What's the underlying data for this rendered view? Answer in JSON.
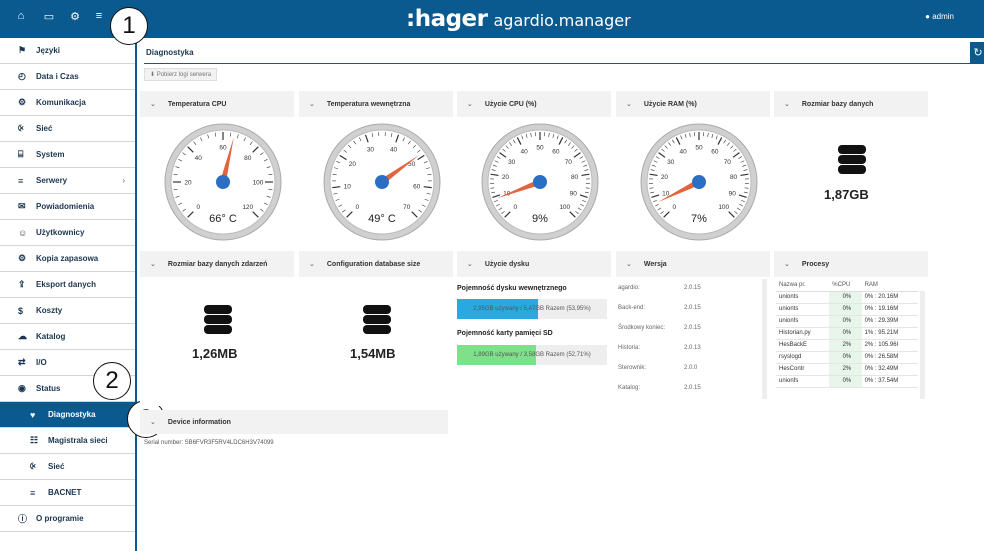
{
  "topbar": {
    "icons": [
      "home-icon",
      "monitor-icon",
      "gears-icon",
      "menu-icon"
    ],
    "logo": ":hager",
    "logo_sub": "agardio.manager",
    "user": "admin"
  },
  "callouts": [
    "1",
    "2",
    "3"
  ],
  "sidebar": {
    "items": [
      {
        "label": "Języki",
        "icon": "flag-icon"
      },
      {
        "label": "Data i Czas",
        "icon": "clock-icon"
      },
      {
        "label": "Komunikacja",
        "icon": "gears-icon"
      },
      {
        "label": "Sieć",
        "icon": "share-icon"
      },
      {
        "label": "System",
        "icon": "hdd-icon"
      },
      {
        "label": "Serwery",
        "icon": "server-icon",
        "arrow": "›"
      },
      {
        "label": "Powiadomienia",
        "icon": "envelope-icon"
      },
      {
        "label": "Użytkownicy",
        "icon": "users-icon"
      },
      {
        "label": "Kopia zapasowa",
        "icon": "gears-icon"
      },
      {
        "label": "Eksport danych",
        "icon": "upload-icon"
      },
      {
        "label": "Koszty",
        "icon": "dollar-icon"
      },
      {
        "label": "Katalog",
        "icon": "cloud-icon"
      },
      {
        "label": "I/O",
        "icon": "exchange-icon"
      },
      {
        "label": "Status",
        "icon": "eye-icon"
      },
      {
        "label": "Diagnostyka",
        "icon": "heartbeat-icon",
        "active": true,
        "sub": true
      },
      {
        "label": "Magistrala sieci",
        "icon": "sitemap-icon",
        "sub": true
      },
      {
        "label": "Sieć",
        "icon": "share-icon",
        "sub": true
      },
      {
        "label": "BACNET",
        "icon": "server-icon",
        "sub": true
      },
      {
        "label": "O programie",
        "icon": "info-icon"
      }
    ]
  },
  "main": {
    "title": "Diagnostyka",
    "download_button": "Pobierz logi serwera"
  },
  "gauges": [
    {
      "title": "Temperatura CPU",
      "value_text": "66° C",
      "value": 66,
      "min": 0,
      "max": 120,
      "ticks": [
        "0",
        "20",
        "40",
        "60",
        "80",
        "100",
        "120"
      ]
    },
    {
      "title": "Temperatura wewnętrzna",
      "value_text": "49° C",
      "value": 49,
      "min": 0,
      "max": 70,
      "ticks": [
        "0",
        "10",
        "20",
        "30",
        "40",
        "50",
        "60",
        "70"
      ]
    },
    {
      "title": "Użycie CPU (%)",
      "value_text": "9%",
      "value": 9,
      "min": 0,
      "max": 100,
      "ticks": [
        "0",
        "10",
        "20",
        "30",
        "40",
        "50",
        "60",
        "70",
        "80",
        "90",
        "100"
      ]
    },
    {
      "title": "Użycie RAM (%)",
      "value_text": "7%",
      "value": 7,
      "min": 0,
      "max": 100,
      "ticks": [
        "0",
        "10",
        "20",
        "30",
        "40",
        "50",
        "60",
        "70",
        "80",
        "90",
        "100"
      ]
    }
  ],
  "db_size": {
    "title": "Rozmiar bazy danych",
    "value": "1,87GB"
  },
  "events_db": {
    "title": "Rozmiar bazy danych zdarzeń",
    "value": "1,26MB"
  },
  "config_db": {
    "title": "Configuration database size",
    "value": "1,54MB"
  },
  "disk": {
    "title": "Użycie dysku",
    "internal_title": "Pojemność dysku wewnętrznego",
    "internal_text": "2,95GB używany / 5,47GB Razem (53,95%)",
    "internal_fraction": 0.5395,
    "sd_title": "Pojemność karty pamięci SD",
    "sd_text": "1,89GB używany / 3,58GB Razem (52,71%)",
    "sd_fraction": 0.5271
  },
  "version": {
    "title": "Wersja",
    "rows": [
      {
        "name": "agardio:",
        "value": "2.0.15"
      },
      {
        "name": "Back-end:",
        "value": "2.0.15"
      },
      {
        "name": "Środkowy koniec:",
        "value": "2.0.15"
      },
      {
        "name": "Historia:",
        "value": "2.0.13"
      },
      {
        "name": "Sterownik:",
        "value": "2.0.0"
      },
      {
        "name": "Katalog:",
        "value": "2.0.15"
      }
    ]
  },
  "processes": {
    "title": "Procesy",
    "headers": [
      "Nazwa pr.",
      "%CPU",
      "RAM"
    ],
    "rows": [
      [
        "unionts",
        "0%",
        "0% : 20.16M"
      ],
      [
        "unionts",
        "0%",
        "0% : 19.16M"
      ],
      [
        "unionfs",
        "0%",
        "0% : 29.39M"
      ],
      [
        "Historian.py",
        "0%",
        "1% : 95.21M"
      ],
      [
        "HesBackE",
        "2%",
        "2% : 105.96I"
      ],
      [
        "rsyslogd",
        "0%",
        "0% : 26.58M"
      ],
      [
        "HesContr",
        "2%",
        "0% : 32.49M"
      ],
      [
        "unionfs",
        "0%",
        "0% : 37.54M"
      ]
    ]
  },
  "device": {
    "title": "Device information",
    "serial": "Serial number: SB6FVR3F5RV4LDC6H3V74099"
  },
  "colors": {
    "primary": "#0a5a8f",
    "needle": "#e0643c",
    "hub": "#2b6fc4",
    "bar_blue": "#29a9e0",
    "bar_green": "#7ee08a"
  }
}
